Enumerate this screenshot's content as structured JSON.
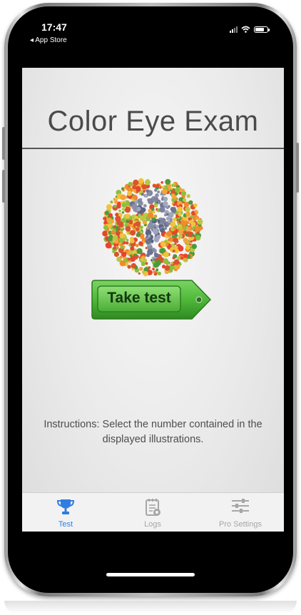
{
  "status_bar": {
    "time": "17:47",
    "back_label": "◂ App Store"
  },
  "app": {
    "title": "Color Eye Exam",
    "take_test_label": "Take test",
    "instructions": "Instructions: Select the number contained in the displayed illustrations."
  },
  "tabs": [
    {
      "label": "Test",
      "icon": "trophy-icon",
      "active": true
    },
    {
      "label": "Logs",
      "icon": "logs-icon",
      "active": false
    },
    {
      "label": "Pro Settings",
      "icon": "sliders-icon",
      "active": false
    }
  ],
  "colors": {
    "accent": "#2f7de1",
    "button_green": "#4fb83a",
    "inactive_tab": "#a6a6a6"
  }
}
